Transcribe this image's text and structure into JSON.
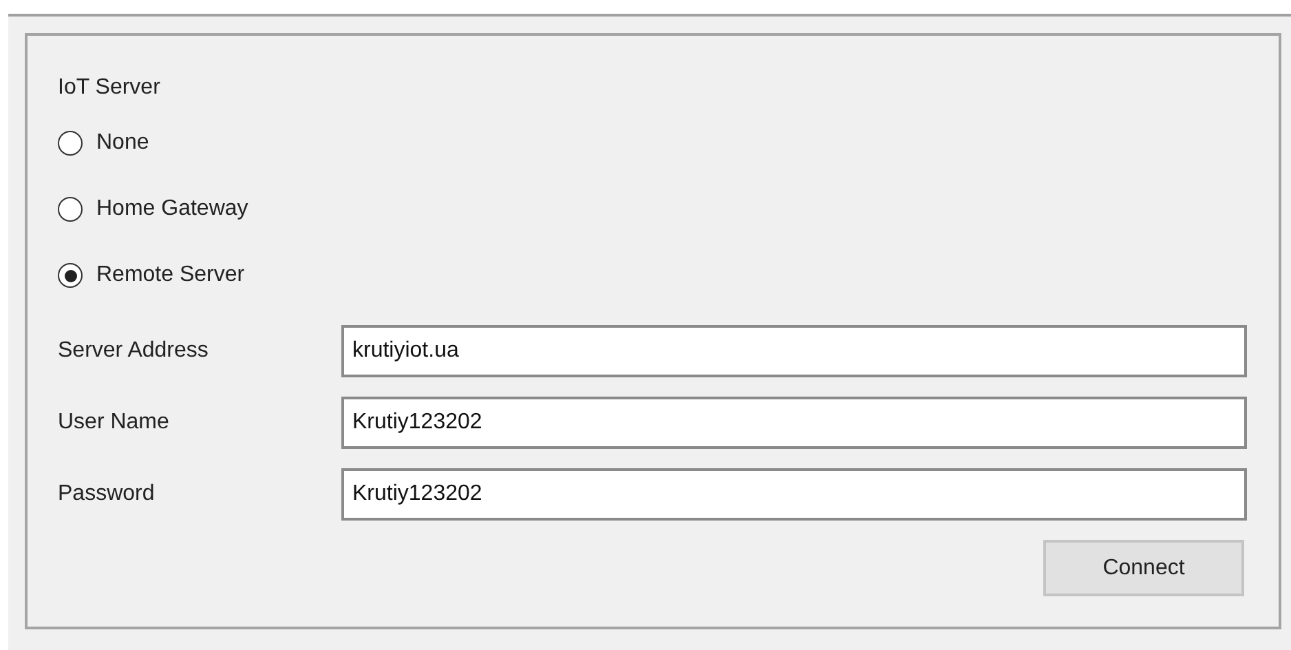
{
  "group": {
    "title": "IoT Server",
    "options": [
      {
        "label": "None",
        "selected": false
      },
      {
        "label": "Home Gateway",
        "selected": false
      },
      {
        "label": "Remote Server",
        "selected": true
      }
    ],
    "fields": [
      {
        "label": "Server Address",
        "value": "krutiyiot.ua"
      },
      {
        "label": "User Name",
        "value": "Krutiy123202"
      },
      {
        "label": "Password",
        "value": "Krutiy123202"
      }
    ],
    "button": "Connect"
  }
}
